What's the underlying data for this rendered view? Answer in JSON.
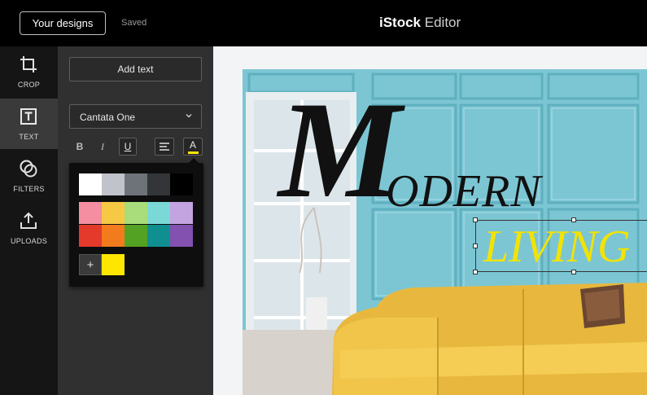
{
  "header": {
    "your_designs": "Your designs",
    "saved": "Saved",
    "brand_bold": "iStock",
    "brand_light": "Editor"
  },
  "rail": {
    "items": [
      {
        "label": "CROP",
        "icon": "crop-icon"
      },
      {
        "label": "TEXT",
        "icon": "text-icon"
      },
      {
        "label": "FILTERS",
        "icon": "filters-icon"
      },
      {
        "label": "UPLOADS",
        "icon": "uploads-icon"
      }
    ],
    "active": "TEXT"
  },
  "panel": {
    "add_text": "Add text",
    "font_value": "Cantata One",
    "format": {
      "bold": "B",
      "italic": "I",
      "underline": "U",
      "color": "A"
    },
    "palette": {
      "colors": [
        [
          "#ffffff",
          "#c0c3c9",
          "#6e737a",
          "#333538",
          "#000000"
        ],
        [
          "#f48ea0",
          "#f7c844",
          "#a9dc7b",
          "#7ad9d6",
          "#c3a4e0"
        ],
        [
          "#e43a2c",
          "#f27b1d",
          "#54a223",
          "#0f8f90",
          "#8351b0"
        ]
      ],
      "add_label": "+",
      "custom": [
        "#ffe600"
      ]
    }
  },
  "canvas": {
    "headline_big": "M",
    "headline_rest": "ODERN",
    "subline": "LIVING",
    "headline_color": "#111111",
    "subline_color": "#f3e300"
  }
}
